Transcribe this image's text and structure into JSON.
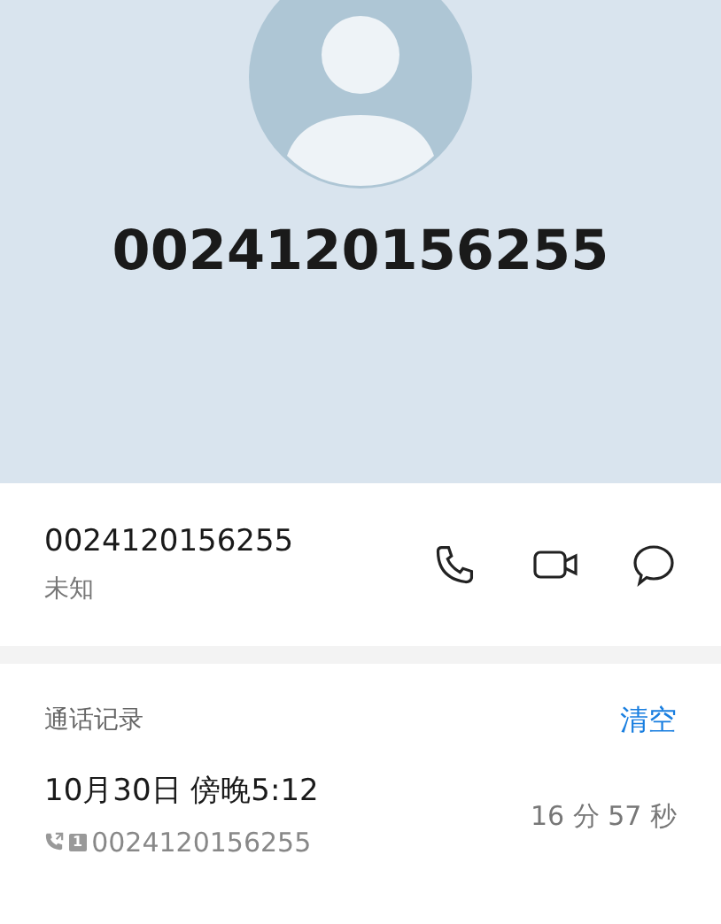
{
  "header": {
    "name": "0024120156255"
  },
  "contact": {
    "number": "0024120156255",
    "location": "未知"
  },
  "call_log": {
    "title": "通话记录",
    "clear": "清空",
    "entries": [
      {
        "time": "10月30日 傍晚5:12",
        "number": "0024120156255",
        "sim": "1",
        "duration": "16 分 57 秒"
      }
    ]
  }
}
